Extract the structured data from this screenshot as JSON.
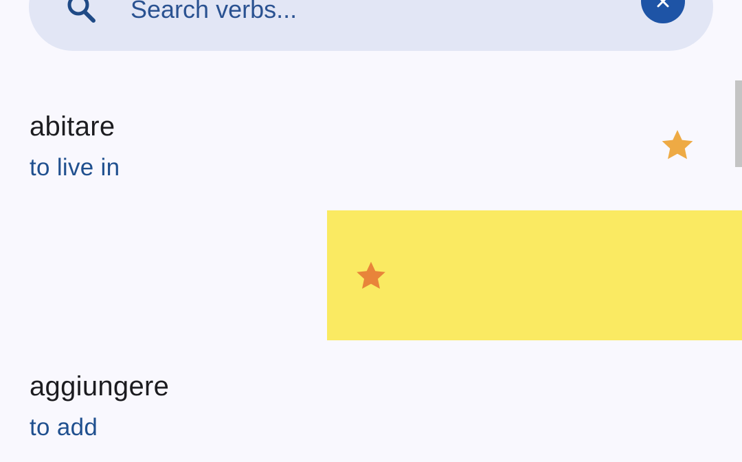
{
  "search": {
    "placeholder": "Search verbs..."
  },
  "icons": {
    "search": "search-icon",
    "clear": "close-icon",
    "favorite": "star-icon"
  },
  "colors": {
    "background": "#f9f8fe",
    "search_bar": "#e2e6f5",
    "accent": "#1e54a6",
    "favorite_star": "#eeaa44",
    "swipe_background": "#faea62",
    "swipe_star": "#e8843a"
  },
  "verbs": [
    {
      "name": "abitare",
      "translation": "to live in",
      "favorite": true
    },
    {
      "name": "aggiungere",
      "translation": "to add",
      "favorite": false
    }
  ]
}
